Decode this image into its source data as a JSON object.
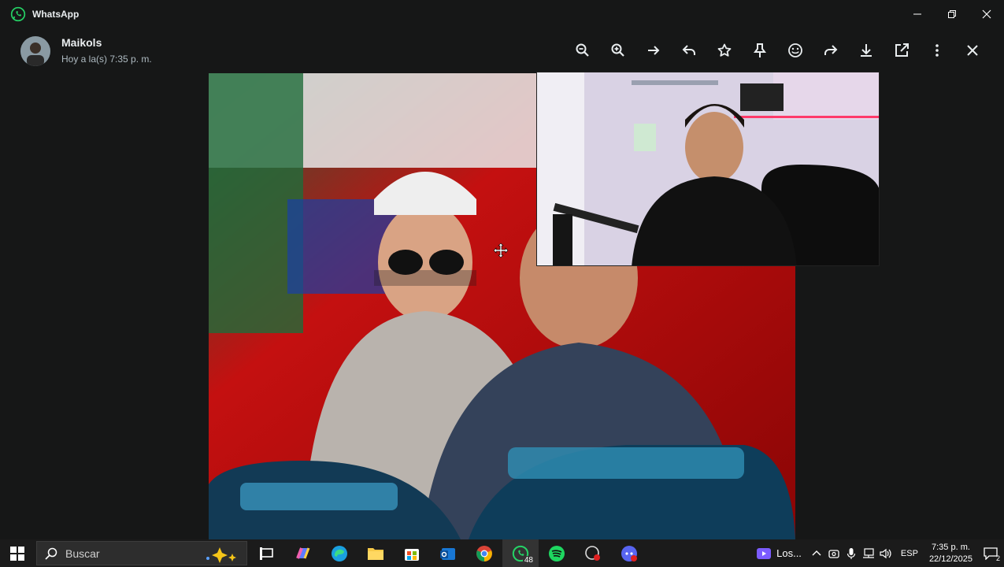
{
  "app": {
    "title": "WhatsApp"
  },
  "viewer": {
    "contact_name": "Maikols",
    "timestamp": "Hoy a la(s) 7:35 p. m.",
    "toolbar": [
      "zoom-out",
      "zoom-in",
      "next",
      "reply",
      "star",
      "pin",
      "react",
      "forward",
      "download",
      "open-external",
      "more",
      "close"
    ]
  },
  "taskbar": {
    "search_placeholder": "Buscar",
    "whatsapp_badge": "48",
    "media_label": "Los...",
    "language": "ESP",
    "time": "7:35 p. m.",
    "date": "22/12/2025",
    "notification_count": "2"
  },
  "colors": {
    "accent": "#25d366",
    "bg": "#161717"
  }
}
